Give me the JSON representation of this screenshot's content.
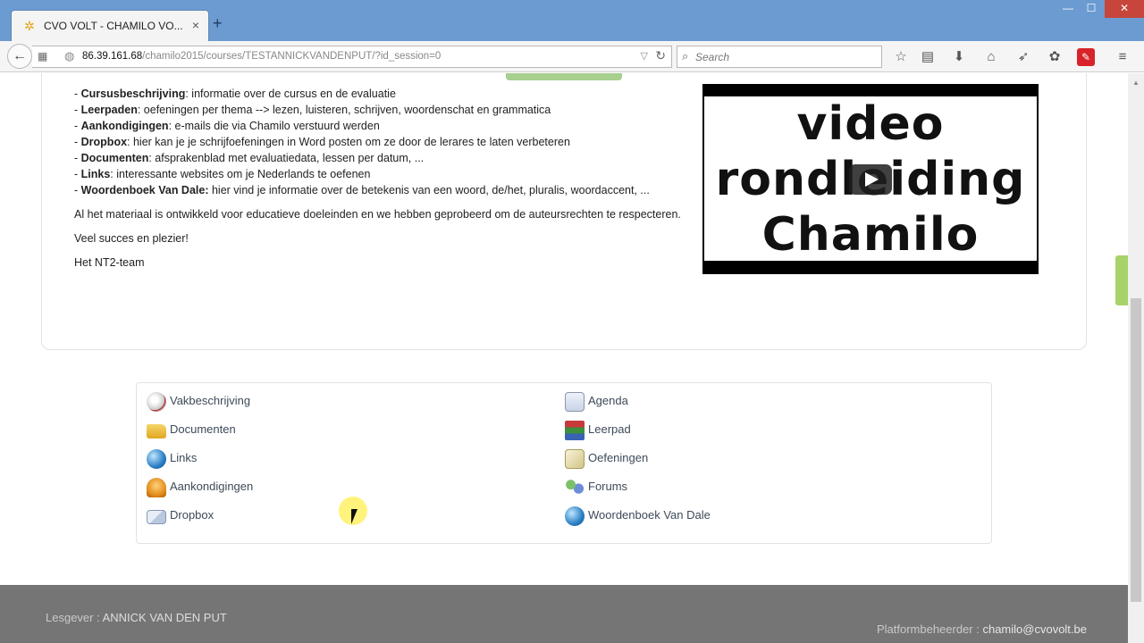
{
  "browser": {
    "tab_title": "CVO VOLT - CHAMILO VO...",
    "tab_close": "×",
    "new_tab": "+",
    "url_host": "86.39.161.68",
    "url_path": "/chamilo2015/courses/TESTANNICKVANDENPUT/?id_session=0",
    "search_placeholder": "Search",
    "window_buttons": {
      "minimize": "—",
      "maximize": "☐",
      "close": "✕"
    }
  },
  "intro": {
    "items": [
      {
        "term": "Cursusbeschrijving",
        "text": ": informatie over de cursus en de evaluatie"
      },
      {
        "term": "Leerpaden",
        "text": ": oefeningen per thema --> lezen, luisteren, schrijven, woordenschat en grammatica"
      },
      {
        "term": "Aankondigingen",
        "text": ": e-mails die via Chamilo verstuurd werden"
      },
      {
        "term": "Dropbox",
        "text": ": hier kan je je schrijfoefeningen in Word posten om ze door de lerares te laten verbeteren"
      },
      {
        "term": "Documenten",
        "text": ": afsprakenblad met evaluatiedata, lessen per datum, ..."
      },
      {
        "term": "Links",
        "text": ": interessante websites om je Nederlands te oefenen"
      },
      {
        "term": "Woordenboek Van Dale:",
        "text": " hier vind je informatie over de betekenis van een woord, de/het, pluralis, woordaccent, ..."
      }
    ],
    "paragraph_1": "Al het materiaal is ontwikkeld voor educatieve doeleinden en we hebben geprobeerd om de auteursrechten te respecteren.",
    "paragraph_2": "Veel succes en plezier!",
    "paragraph_3": "Het NT2-team"
  },
  "video": {
    "line_1": "video",
    "line_2": "rondleiding",
    "line_3": "Chamilo"
  },
  "tools": {
    "left": [
      {
        "label": "Vakbeschrijving",
        "icon": "course-description-icon"
      },
      {
        "label": "Documenten",
        "icon": "folder-icon"
      },
      {
        "label": "Links",
        "icon": "globe-icon"
      },
      {
        "label": "Aankondigingen",
        "icon": "bell-icon"
      },
      {
        "label": "Dropbox",
        "icon": "envelope-icon"
      }
    ],
    "right": [
      {
        "label": "Agenda",
        "icon": "calendar-icon"
      },
      {
        "label": "Leerpad",
        "icon": "books-icon"
      },
      {
        "label": "Oefeningen",
        "icon": "checklist-icon"
      },
      {
        "label": "Forums",
        "icon": "forum-users-icon"
      },
      {
        "label": "Woordenboek Van Dale",
        "icon": "dictionary-globe-icon"
      }
    ]
  },
  "footer": {
    "teacher_prefix": "Lesgever : ",
    "teacher_name": "ANNICK VAN DEN PUT",
    "admin_prefix": "Platformbeheerder : ",
    "admin_email": "chamilo@cvovolt.be"
  }
}
